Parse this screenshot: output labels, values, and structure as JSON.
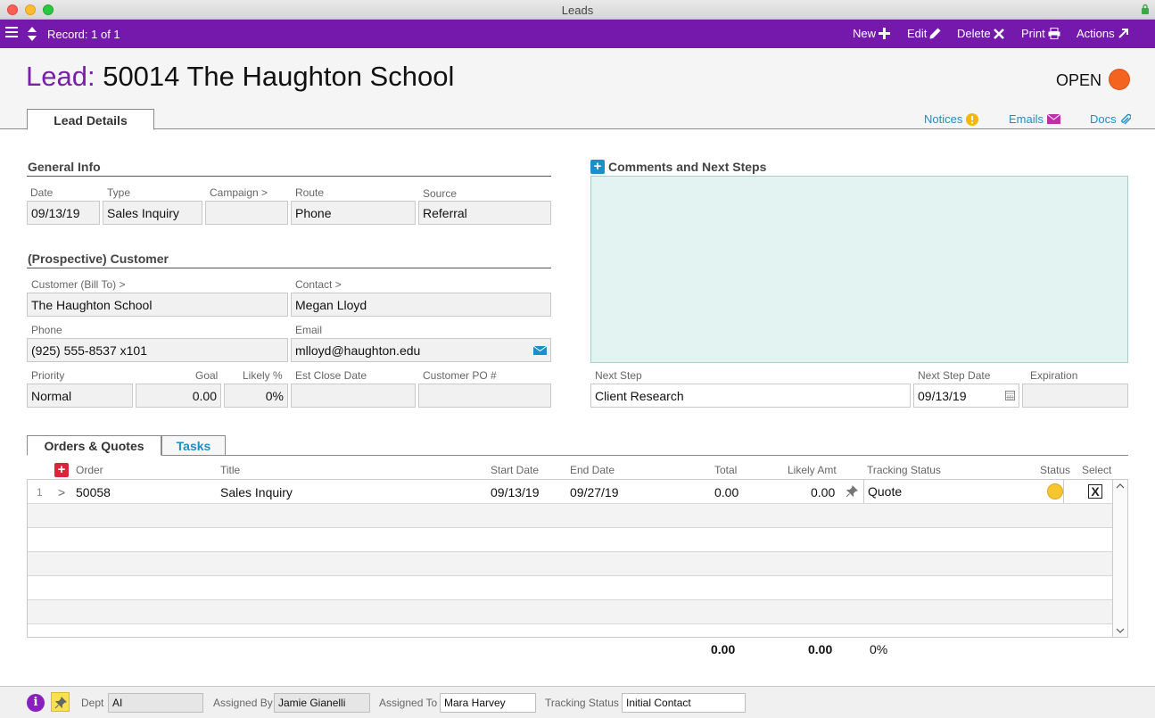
{
  "window": {
    "title": "Leads"
  },
  "toolbar": {
    "record": "Record: 1 of 1",
    "new_label": "New",
    "edit_label": "Edit",
    "delete_label": "Delete",
    "print_label": "Print",
    "actions_label": "Actions",
    "bg_color": "#7419ab"
  },
  "header": {
    "title_prefix": "Lead:",
    "title_value": "50014 The Haughton School",
    "status_label": "OPEN",
    "status_color": "#f4641e",
    "tab_label": "Lead Details",
    "links": {
      "notices": "Notices",
      "emails": "Emails",
      "docs": "Docs"
    }
  },
  "general_info": {
    "title": "General Info",
    "labels": {
      "date": "Date",
      "type": "Type",
      "campaign": "Campaign >",
      "route": "Route",
      "source": "Source"
    },
    "values": {
      "date": "09/13/19",
      "type": "Sales Inquiry",
      "campaign": "",
      "route": "Phone",
      "source": "Referral"
    }
  },
  "customer": {
    "title": "(Prospective) Customer",
    "labels": {
      "customer": "Customer (Bill To) >",
      "contact": "Contact >",
      "phone": "Phone",
      "email": "Email",
      "priority": "Priority",
      "goal": "Goal",
      "likely": "Likely %",
      "close_date": "Est Close Date",
      "po": "Customer PO #"
    },
    "values": {
      "customer": "The Haughton School",
      "contact": "Megan Lloyd",
      "phone": "(925) 555-8537 x101",
      "email": "mlloyd@haughton.edu",
      "priority": "Normal",
      "goal": "0.00",
      "likely": "0%",
      "close_date": "",
      "po": ""
    }
  },
  "comments": {
    "title": "Comments and Next Steps",
    "text": "",
    "labels": {
      "next_step": "Next Step",
      "next_step_date": "Next Step Date",
      "expiration": "Expiration"
    },
    "values": {
      "next_step": "Client Research",
      "next_step_date": "09/13/19",
      "expiration": ""
    }
  },
  "orders": {
    "tabs": [
      "Orders & Quotes",
      "Tasks"
    ],
    "columns": {
      "order": "Order",
      "title": "Title",
      "start": "Start Date",
      "end": "End Date",
      "total": "Total",
      "likely_amt": "Likely Amt",
      "tracking": "Tracking Status",
      "status": "Status",
      "select": "Select"
    },
    "rows": [
      {
        "num": "1",
        "arrow": ">",
        "order": "50058",
        "title": "Sales Inquiry",
        "start": "09/13/19",
        "end": "09/27/19",
        "total": "0.00",
        "likely_amt": "0.00",
        "tracking": "Quote",
        "select": "X"
      }
    ],
    "totals": {
      "total": "0.00",
      "likely_amt": "0.00",
      "likely_pct": "0%"
    }
  },
  "footer": {
    "dept_label": "Dept",
    "dept": "AI",
    "assigned_by_label": "Assigned By",
    "assigned_by": "Jamie Gianelli",
    "assigned_to_label": "Assigned To",
    "assigned_to": "Mara Harvey",
    "tracking_label": "Tracking Status",
    "tracking": "Initial Contact"
  }
}
